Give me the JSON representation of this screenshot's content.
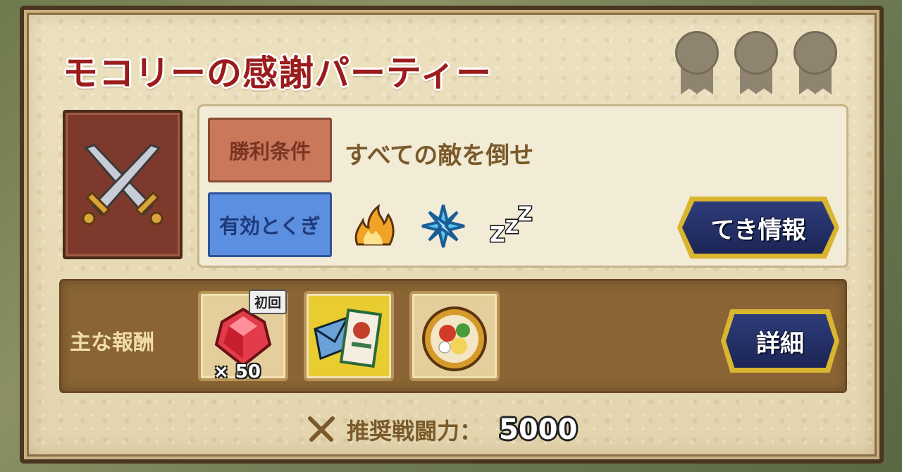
{
  "title": "モコリーの感謝パーティー",
  "conditions": {
    "win_label": "勝利条件",
    "win_text": "すべての敵を倒せ",
    "effective_label": "有効とくぎ",
    "effective_icons": [
      "fire-icon",
      "ice-icon",
      "sleep-icon"
    ],
    "sleep_text": "ZZZ"
  },
  "enemy_button": {
    "label": "てき情報"
  },
  "rewards": {
    "label": "主な報酬",
    "items": [
      {
        "icon": "red-gem-icon",
        "badge": "初回",
        "quantity": "× 50"
      },
      {
        "icon": "letter-card-icon"
      },
      {
        "icon": "food-plate-icon"
      }
    ],
    "detail_button": "詳細"
  },
  "recommended_power": {
    "label": "推奨戦闘力：",
    "value": "5000"
  },
  "medals": [
    "medal-icon",
    "medal-icon",
    "medal-icon"
  ],
  "colors": {
    "title": "#9b1c1c",
    "panel": "#e9dcb8",
    "button": "#1b2555",
    "button_border": "#d9b530"
  }
}
